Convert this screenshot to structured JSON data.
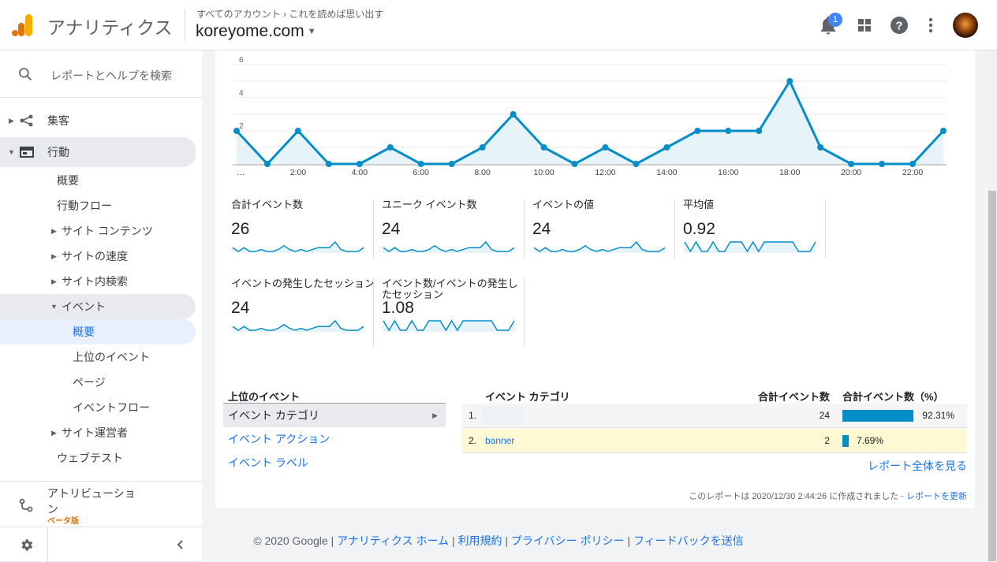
{
  "header": {
    "app_name": "アナリティクス",
    "breadcrumb_all": "すべてのアカウント",
    "breadcrumb_sep": "›",
    "breadcrumb_account": "これを読めば思い出す",
    "property": "koreyome.com",
    "notification_count": "1",
    "icons": [
      "bell-icon",
      "apps-grid-icon",
      "help-icon",
      "more-vert-icon"
    ]
  },
  "sidebar": {
    "search_placeholder": "レポートとヘルプを検索",
    "items": [
      {
        "label": "集客"
      },
      {
        "label": "行動"
      },
      {
        "label": "概要"
      },
      {
        "label": "行動フロー"
      },
      {
        "label": "サイト コンテンツ"
      },
      {
        "label": "サイトの速度"
      },
      {
        "label": "サイト内検索"
      },
      {
        "label": "イベント"
      },
      {
        "label": "概要"
      },
      {
        "label": "上位のイベント"
      },
      {
        "label": "ページ"
      },
      {
        "label": "イベントフロー"
      },
      {
        "label": "サイト運営者"
      },
      {
        "label": "ウェブテスト"
      }
    ],
    "attribution": "アトリビューション",
    "beta": "ベータ版"
  },
  "chart_data": {
    "type": "area",
    "x": [
      "…",
      "1:00",
      "2:00",
      "3:00",
      "4:00",
      "5:00",
      "6:00",
      "7:00",
      "8:00",
      "9:00",
      "10:00",
      "11:00",
      "12:00",
      "13:00",
      "14:00",
      "15:00",
      "16:00",
      "17:00",
      "18:00",
      "19:00",
      "20:00",
      "21:00",
      "22:00",
      "23:00"
    ],
    "x_tick_labels": [
      "…",
      "2:00",
      "4:00",
      "6:00",
      "8:00",
      "10:00",
      "12:00",
      "14:00",
      "16:00",
      "18:00",
      "20:00",
      "22:00"
    ],
    "series": [
      {
        "values": [
          2,
          0,
          2,
          0,
          0,
          1,
          0,
          0,
          1,
          3,
          1,
          0,
          1,
          0,
          1,
          2,
          2,
          2,
          5,
          1,
          0,
          0,
          0,
          2
        ]
      }
    ],
    "y_tick_labels": [
      "6",
      "4",
      "2"
    ],
    "ylim": [
      0,
      6
    ],
    "grid": true,
    "color": "#058dc7"
  },
  "metrics": [
    {
      "label": "合計イベント数",
      "value": "26"
    },
    {
      "label": "ユニーク イベント数",
      "value": "24"
    },
    {
      "label": "イベントの値",
      "value": "24"
    },
    {
      "label": "平均値",
      "value": "0.92"
    },
    {
      "label": "イベントの発生したセッション",
      "value": "24"
    },
    {
      "label": "イベント数/イベントの発生したセッション",
      "value": "1.08"
    }
  ],
  "table": {
    "left_title": "上位のイベント",
    "dimensions": [
      "イベント カテゴリ",
      "イベント アクション",
      "イベント ラベル"
    ],
    "col_category": "イベント カテゴリ",
    "col_total": "合計イベント数",
    "col_pct": "合計イベント数（%）",
    "rows": [
      {
        "index": "1.",
        "category": "",
        "total": "24",
        "pct": "92.31%",
        "fraction": 0.9231
      },
      {
        "index": "2.",
        "category": "banner",
        "total": "2",
        "pct": "7.69%",
        "fraction": 0.0769
      }
    ],
    "full_report": "レポート全体を見る",
    "created_note": "このレポートは 2020/12/30 2:44:26 に作成されました - ",
    "refresh": "レポートを更新"
  },
  "footer": {
    "copyright": "© 2020 Google",
    "links": [
      "アナリティクス ホーム",
      "利用規約",
      "プライバシー ポリシー",
      "フィードバックを送信"
    ]
  }
}
